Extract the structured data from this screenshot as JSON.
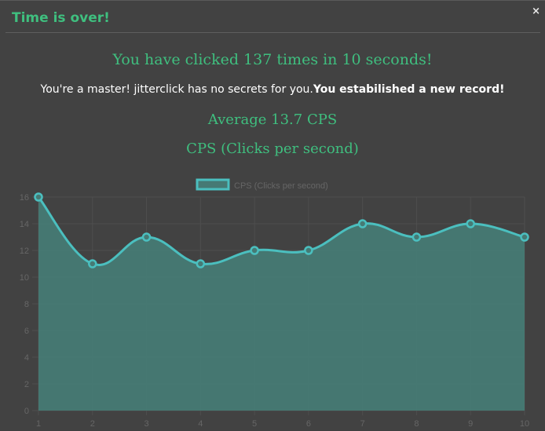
{
  "dialog": {
    "title": "Time is over!",
    "close_label": "×"
  },
  "result": {
    "summary": "You have clicked 137 times in 10 seconds!",
    "rank_text": "You're a master! jitterclick has no secrets for you.",
    "record_text": "You estabilished a new record!",
    "average": "Average 13.7 CPS",
    "chart_heading": "CPS (Clicks per second)"
  },
  "colors": {
    "accent": "#3fbf7f",
    "line": "#4bbfbf",
    "fill": "#467a74",
    "grid": "#4e4e4e",
    "background": "#424242"
  },
  "chart_data": {
    "type": "area",
    "x": [
      1,
      2,
      3,
      4,
      5,
      6,
      7,
      8,
      9,
      10
    ],
    "series": [
      {
        "name": "CPS (Clicks per second)",
        "values": [
          16,
          11,
          13,
          11,
          12,
          12,
          14,
          13,
          14,
          13
        ]
      }
    ],
    "ylim": [
      0,
      16
    ],
    "yticks": [
      0,
      2,
      4,
      6,
      8,
      10,
      12,
      14,
      16
    ],
    "xticks": [
      "1",
      "2",
      "3",
      "4",
      "5",
      "6",
      "7",
      "8",
      "9",
      "10"
    ],
    "grid": true,
    "legend": "top-center"
  }
}
